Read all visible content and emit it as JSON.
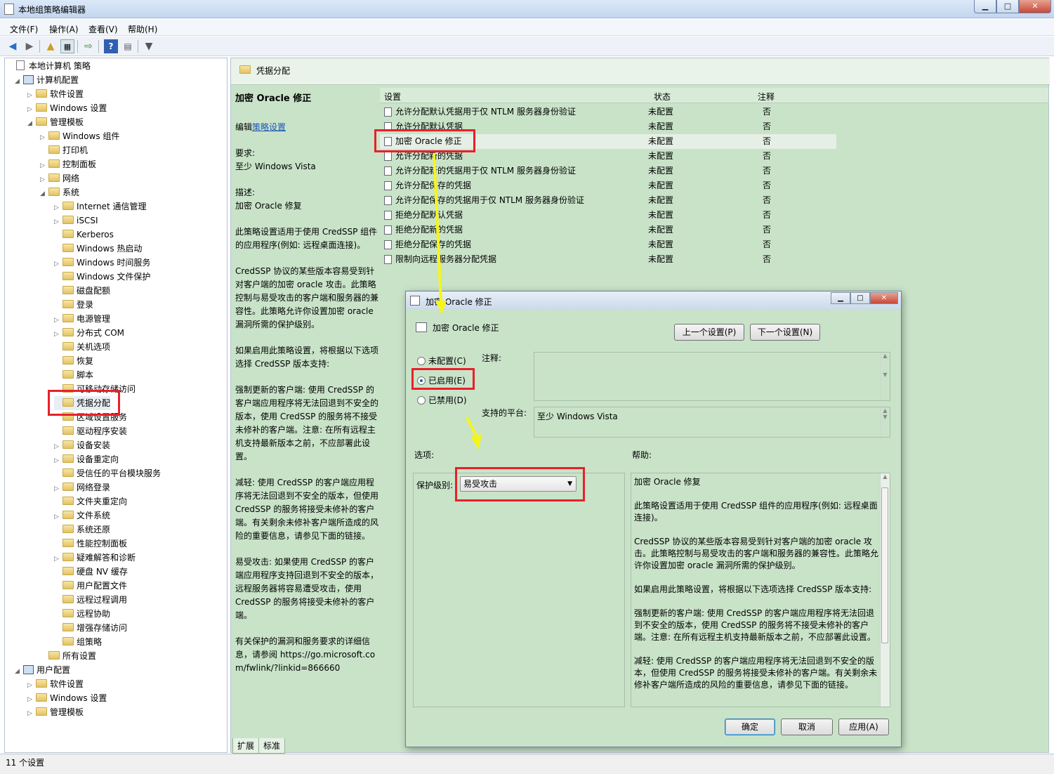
{
  "window": {
    "title": "本地组策略编辑器",
    "controls": [
      "minimize",
      "maximize",
      "close"
    ]
  },
  "menu": [
    "文件(F)",
    "操作(A)",
    "查看(V)",
    "帮助(H)"
  ],
  "toolbar": [
    "back-icon",
    "forward-icon",
    "up-icon",
    "show-hide-tree-icon",
    "export-icon",
    "help-icon",
    "properties-icon",
    "filter-icon"
  ],
  "tree": [
    {
      "label": "本地计算机 策略",
      "level": 0,
      "icon": "doc",
      "exp": ""
    },
    {
      "label": "计算机配置",
      "level": 1,
      "icon": "pc",
      "exp": "◢"
    },
    {
      "label": "软件设置",
      "level": 2,
      "icon": "folder",
      "exp": "▷"
    },
    {
      "label": "Windows 设置",
      "level": 2,
      "icon": "folder",
      "exp": "▷"
    },
    {
      "label": "管理模板",
      "level": 2,
      "icon": "folder",
      "exp": "◢"
    },
    {
      "label": "Windows 组件",
      "level": 3,
      "icon": "folder",
      "exp": "▷"
    },
    {
      "label": "打印机",
      "level": 3,
      "icon": "folder",
      "exp": ""
    },
    {
      "label": "控制面板",
      "level": 3,
      "icon": "folder",
      "exp": "▷"
    },
    {
      "label": "网络",
      "level": 3,
      "icon": "folder",
      "exp": "▷"
    },
    {
      "label": "系统",
      "level": 3,
      "icon": "folder",
      "exp": "◢"
    },
    {
      "label": "Internet 通信管理",
      "level": 4,
      "icon": "folder",
      "exp": "▷"
    },
    {
      "label": "iSCSI",
      "level": 4,
      "icon": "folder",
      "exp": "▷"
    },
    {
      "label": "Kerberos",
      "level": 4,
      "icon": "folder",
      "exp": ""
    },
    {
      "label": "Windows 热启动",
      "level": 4,
      "icon": "folder",
      "exp": ""
    },
    {
      "label": "Windows 时间服务",
      "level": 4,
      "icon": "folder",
      "exp": "▷"
    },
    {
      "label": "Windows 文件保护",
      "level": 4,
      "icon": "folder",
      "exp": ""
    },
    {
      "label": "磁盘配额",
      "level": 4,
      "icon": "folder",
      "exp": ""
    },
    {
      "label": "登录",
      "level": 4,
      "icon": "folder",
      "exp": ""
    },
    {
      "label": "电源管理",
      "level": 4,
      "icon": "folder",
      "exp": "▷"
    },
    {
      "label": "分布式 COM",
      "level": 4,
      "icon": "folder",
      "exp": "▷"
    },
    {
      "label": "关机选项",
      "level": 4,
      "icon": "folder",
      "exp": ""
    },
    {
      "label": "恢复",
      "level": 4,
      "icon": "folder",
      "exp": ""
    },
    {
      "label": "脚本",
      "level": 4,
      "icon": "folder",
      "exp": ""
    },
    {
      "label": "可移动存储访问",
      "level": 4,
      "icon": "folder",
      "exp": ""
    },
    {
      "label": "凭据分配",
      "level": 4,
      "icon": "folder",
      "exp": "",
      "selected": true
    },
    {
      "label": "区域设置服务",
      "level": 4,
      "icon": "folder",
      "exp": ""
    },
    {
      "label": "驱动程序安装",
      "level": 4,
      "icon": "folder",
      "exp": ""
    },
    {
      "label": "设备安装",
      "level": 4,
      "icon": "folder",
      "exp": "▷"
    },
    {
      "label": "设备重定向",
      "level": 4,
      "icon": "folder",
      "exp": "▷"
    },
    {
      "label": "受信任的平台模块服务",
      "level": 4,
      "icon": "folder",
      "exp": ""
    },
    {
      "label": "网络登录",
      "level": 4,
      "icon": "folder",
      "exp": "▷"
    },
    {
      "label": "文件夹重定向",
      "level": 4,
      "icon": "folder",
      "exp": ""
    },
    {
      "label": "文件系统",
      "level": 4,
      "icon": "folder",
      "exp": "▷"
    },
    {
      "label": "系统还原",
      "level": 4,
      "icon": "folder",
      "exp": ""
    },
    {
      "label": "性能控制面板",
      "level": 4,
      "icon": "folder",
      "exp": ""
    },
    {
      "label": "疑难解答和诊断",
      "level": 4,
      "icon": "folder",
      "exp": "▷"
    },
    {
      "label": "硬盘 NV 缓存",
      "level": 4,
      "icon": "folder",
      "exp": ""
    },
    {
      "label": "用户配置文件",
      "level": 4,
      "icon": "folder",
      "exp": ""
    },
    {
      "label": "远程过程调用",
      "level": 4,
      "icon": "folder",
      "exp": ""
    },
    {
      "label": "远程协助",
      "level": 4,
      "icon": "folder",
      "exp": ""
    },
    {
      "label": "增强存储访问",
      "level": 4,
      "icon": "folder",
      "exp": ""
    },
    {
      "label": "组策略",
      "level": 4,
      "icon": "folder",
      "exp": ""
    },
    {
      "label": "所有设置",
      "level": 3,
      "icon": "folder",
      "exp": ""
    },
    {
      "label": "用户配置",
      "level": 1,
      "icon": "pc",
      "exp": "◢"
    },
    {
      "label": "软件设置",
      "level": 2,
      "icon": "folder",
      "exp": "▷"
    },
    {
      "label": "Windows 设置",
      "level": 2,
      "icon": "folder",
      "exp": "▷"
    },
    {
      "label": "管理模板",
      "level": 2,
      "icon": "folder",
      "exp": "▷"
    }
  ],
  "right_header": "凭据分配",
  "desc": {
    "title": "加密 Oracle 修正",
    "edit_prefix": "编辑",
    "edit_link": "策略设置",
    "req_label": "要求:",
    "req_value": "至少 Windows Vista",
    "desc_label": "描述:",
    "desc_value": "加密 Oracle 修复",
    "p1": "此策略设置适用于使用 CredSSP 组件的应用程序(例如: 远程桌面连接)。",
    "p2": "CredSSP 协议的某些版本容易受到针对客户端的加密 oracle 攻击。此策略控制与易受攻击的客户端和服务器的兼容性。此策略允许你设置加密 oracle 漏洞所需的保护级别。",
    "p3": "如果启用此策略设置，将根据以下选项选择 CredSSP 版本支持:",
    "p4": "强制更新的客户端: 使用 CredSSP 的客户端应用程序将无法回退到不安全的版本，使用 CredSSP 的服务将不接受未修补的客户端。注意: 在所有远程主机支持最新版本之前，不应部署此设置。",
    "p5": "减轻: 使用 CredSSP 的客户端应用程序将无法回退到不安全的版本，但使用 CredSSP 的服务将接受未修补的客户端。有关剩余未修补客户端所造成的风险的重要信息，请参见下面的链接。",
    "p6": "易受攻击: 如果使用 CredSSP 的客户端应用程序支持回退到不安全的版本，远程服务器将容易遭受攻击，使用 CredSSP 的服务将接受未修补的客户端。",
    "p7": "有关保护的漏洞和服务要求的详细信息，请参阅 https://go.microsoft.com/fwlink/?linkid=866660"
  },
  "list": {
    "headers": {
      "setting": "设置",
      "state": "状态",
      "comment": "注释"
    },
    "rows": [
      {
        "name": "允许分配默认凭据用于仅 NTLM 服务器身份验证",
        "state": "未配置",
        "comment": "否"
      },
      {
        "name": "允许分配默认凭据",
        "state": "未配置",
        "comment": "否"
      },
      {
        "name": "加密 Oracle 修正",
        "state": "未配置",
        "comment": "否",
        "highlight": true
      },
      {
        "name": "允许分配新的凭据",
        "state": "未配置",
        "comment": "否"
      },
      {
        "name": "允许分配新的凭据用于仅 NTLM 服务器身份验证",
        "state": "未配置",
        "comment": "否"
      },
      {
        "name": "允许分配保存的凭据",
        "state": "未配置",
        "comment": "否"
      },
      {
        "name": "允许分配保存的凭据用于仅 NTLM 服务器身份验证",
        "state": "未配置",
        "comment": "否"
      },
      {
        "name": "拒绝分配默认凭据",
        "state": "未配置",
        "comment": "否"
      },
      {
        "name": "拒绝分配新的凭据",
        "state": "未配置",
        "comment": "否"
      },
      {
        "name": "拒绝分配保存的凭据",
        "state": "未配置",
        "comment": "否"
      },
      {
        "name": "限制向远程服务器分配凭据",
        "state": "未配置",
        "comment": "否"
      }
    ]
  },
  "tabs": [
    "扩展",
    "标准"
  ],
  "status": "11 个设置",
  "dialog": {
    "title": "加密 Oracle 修正",
    "heading": "加密 Oracle 修正",
    "prev": "上一个设置(P)",
    "next": "下一个设置(N)",
    "radios": [
      {
        "label": "未配置(C)",
        "checked": false
      },
      {
        "label": "已启用(E)",
        "checked": true
      },
      {
        "label": "已禁用(D)",
        "checked": false
      }
    ],
    "comment_label": "注释:",
    "platform_label": "支持的平台:",
    "platform_value": "至少 Windows Vista",
    "options_label": "选项:",
    "help_label": "帮助:",
    "protect_label": "保护级别:",
    "protect_value": "易受攻击",
    "help": {
      "p0": "加密 Oracle 修复",
      "p1": "此策略设置适用于使用 CredSSP 组件的应用程序(例如: 远程桌面连接)。",
      "p2": "CredSSP 协议的某些版本容易受到针对客户端的加密 oracle 攻击。此策略控制与易受攻击的客户端和服务器的兼容性。此策略允许你设置加密 oracle 漏洞所需的保护级别。",
      "p3": "如果启用此策略设置，将根据以下选项选择 CredSSP 版本支持:",
      "p4": "强制更新的客户端: 使用 CredSSP 的客户端应用程序将无法回退到不安全的版本，使用 CredSSP 的服务将不接受未修补的客户端。注意: 在所有远程主机支持最新版本之前，不应部署此设置。",
      "p5": "减轻: 使用 CredSSP 的客户端应用程序将无法回退到不安全的版本，但使用 CredSSP 的服务将接受未修补的客户端。有关剩余未修补客户端所造成的风险的重要信息，请参见下面的链接。"
    },
    "ok": "确定",
    "cancel": "取消",
    "apply": "应用(A)"
  },
  "colors": {
    "panel_green": "#c9e3c9",
    "annotation_red": "#e8202a",
    "annotation_yellow": "#f5f51e"
  }
}
